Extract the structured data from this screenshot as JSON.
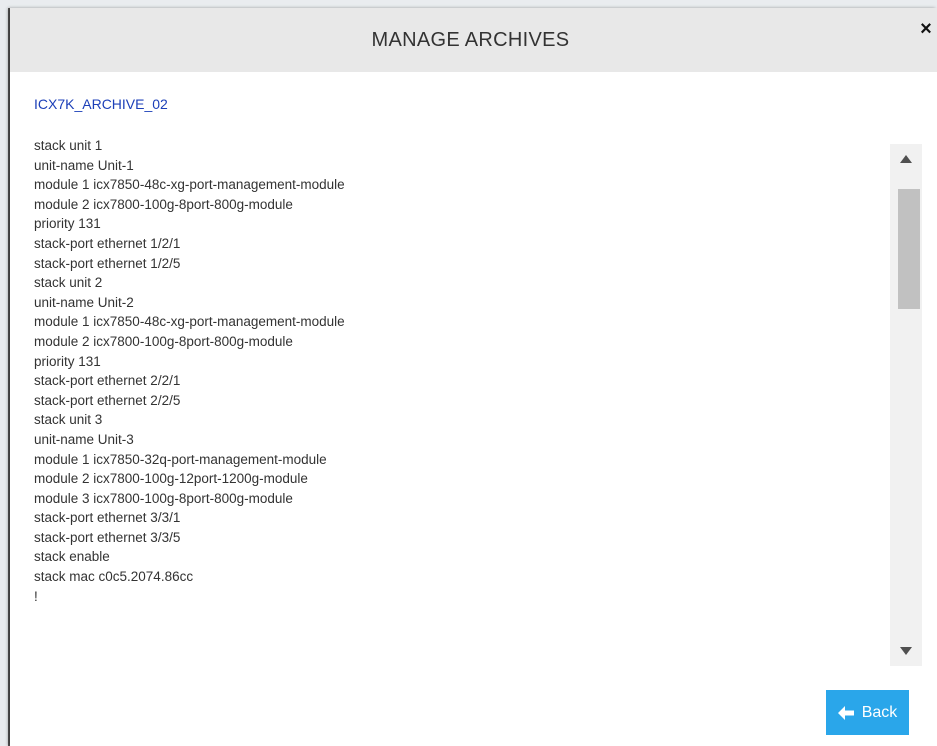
{
  "modal": {
    "title": "MANAGE ARCHIVES",
    "close_icon": "×",
    "archive_name": "ICX7K_ARCHIVE_02"
  },
  "config": {
    "lines": [
      "stack unit 1",
      "unit-name Unit-1",
      "module 1 icx7850-48c-xg-port-management-module",
      "module 2 icx7800-100g-8port-800g-module",
      "priority 131",
      "stack-port ethernet 1/2/1",
      "stack-port ethernet 1/2/5",
      "stack unit 2",
      "unit-name Unit-2",
      "module 1 icx7850-48c-xg-port-management-module",
      "module 2 icx7800-100g-8port-800g-module",
      "priority 131",
      "stack-port ethernet 2/2/1",
      "stack-port ethernet 2/2/5",
      "stack unit 3",
      "unit-name Unit-3",
      "module 1 icx7850-32q-port-management-module",
      "module 2 icx7800-100g-12port-1200g-module",
      "module 3 icx7800-100g-8port-800g-module",
      "stack-port ethernet 3/3/1",
      "stack-port ethernet 3/3/5",
      "stack enable",
      "stack mac c0c5.2074.86cc",
      "!"
    ]
  },
  "footer": {
    "back_label": "Back",
    "back_icon": "arrow-left-icon"
  },
  "colors": {
    "header_bg": "#e8e8e8",
    "link": "#1c3fb8",
    "button_bg": "#2aa6ea"
  }
}
